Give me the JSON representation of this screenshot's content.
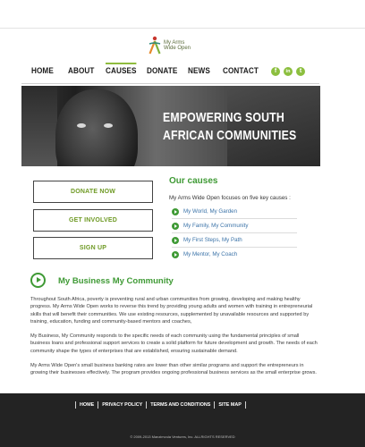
{
  "logo": {
    "line1": "My Arms",
    "line2": "Wide Open",
    "colors": {
      "orange": "#e5892b",
      "green": "#7fb13b",
      "red": "#c8362e",
      "teal": "#2e8a7a"
    }
  },
  "nav": {
    "items": [
      {
        "label": "HOME"
      },
      {
        "label": "ABOUT"
      },
      {
        "label": "CAUSES"
      },
      {
        "label": "DONATE"
      },
      {
        "label": "NEWS"
      },
      {
        "label": "CONTACT"
      }
    ],
    "active": "CAUSES",
    "accent": "#8fbc3e"
  },
  "social": [
    {
      "icon": "facebook-icon",
      "glyph": "f"
    },
    {
      "icon": "linkedin-icon",
      "glyph": "in"
    },
    {
      "icon": "twitter-icon",
      "glyph": "t"
    }
  ],
  "hero": {
    "title_line1": "EMPOWERING SOUTH",
    "title_line2": "AFRICAN COMMUNITIES"
  },
  "actions": {
    "donate": "DONATE NOW",
    "involved": "GET INVOLVED",
    "signup": "SIGN UP"
  },
  "causes": {
    "title": "Our causes",
    "intro": "My Arms Wide Open focuses on five key causes :",
    "items": [
      {
        "label": "My World, My Garden"
      },
      {
        "label": "My Family, My Community"
      },
      {
        "label": "My First Steps, My Path"
      },
      {
        "label": "My Mentor, My Coach"
      }
    ]
  },
  "business": {
    "title": "My Business My Community",
    "paragraphs": [
      "Throughout South Africa, poverty is preventing rural and urban communities from growing, developing and making healthy progress. My Arms Wide Open works to reverse this trend by providing young adults and women with training in entrepreneurial skills that will benefit their communities. We use existing resources, supplemented by unavailable resources and supported by training, education, funding and community-based mentors and coaches,",
      "My Business, My Community responds to the specific needs of each community using the fundamental principles of small business loans and professional support services to create a solid platform for future development and growth. The needs of each community shape the types of enterprises that are established, ensuring sustainable demand.",
      "My Arms Wide Open's small business banking rates are lower than other similar programs and support the entrepreneurs in growing their businesses effectively. The program provides ongoing professional business services as the small enterprise grows."
    ]
  },
  "footer": {
    "links": [
      {
        "label": "HOME"
      },
      {
        "label": "PRIVACY POLICY"
      },
      {
        "label": "TERMS AND CONDITIONS"
      },
      {
        "label": "SITE MAP"
      }
    ],
    "copyright": "© 2009-2013 Manzimvula Ventures, Inc. ALLRIGHTS RESERVED"
  }
}
